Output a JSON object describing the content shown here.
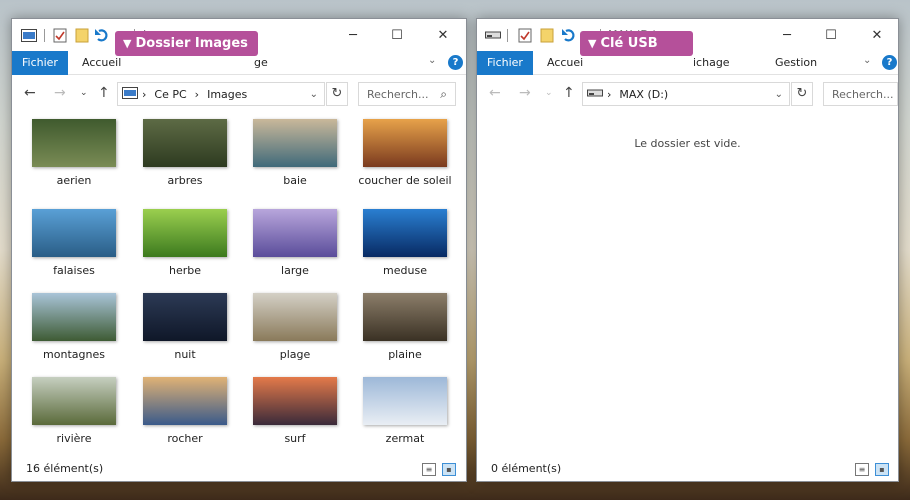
{
  "left": {
    "title": "Images",
    "ribbon": {
      "file": "Fichier",
      "home": "Accueil",
      "view_partial": "ge"
    },
    "callout": "Dossier Images",
    "address": [
      "Ce PC",
      "Images"
    ],
    "search_placeholder": "Recherch...",
    "status": "16 élément(s)",
    "items": [
      {
        "label": "aerien",
        "colors": [
          "#3f5a2e",
          "#7a8c55"
        ]
      },
      {
        "label": "arbres",
        "colors": [
          "#5d6b45",
          "#2e3b20"
        ]
      },
      {
        "label": "baie",
        "colors": [
          "#c9b89a",
          "#406a7a"
        ]
      },
      {
        "label": "coucher de soleil",
        "colors": [
          "#e7a24a",
          "#7a3a1f"
        ]
      },
      {
        "label": "falaises",
        "colors": [
          "#5aa0d6",
          "#2a5d86"
        ]
      },
      {
        "label": "herbe",
        "colors": [
          "#9bcf4f",
          "#3c7a1e"
        ]
      },
      {
        "label": "large",
        "colors": [
          "#b8a6dc",
          "#5a4c9a"
        ]
      },
      {
        "label": "meduse",
        "colors": [
          "#2a7fd1",
          "#082a63"
        ]
      },
      {
        "label": "montagnes",
        "colors": [
          "#a9c4d8",
          "#3e5b34"
        ]
      },
      {
        "label": "nuit",
        "colors": [
          "#2c3a55",
          "#0f1728"
        ]
      },
      {
        "label": "plage",
        "colors": [
          "#d4d0c6",
          "#8a7a5a"
        ]
      },
      {
        "label": "plaine",
        "colors": [
          "#8c7e6a",
          "#3a3124"
        ]
      },
      {
        "label": "rivière",
        "colors": [
          "#c6cfc0",
          "#5a6a3a"
        ]
      },
      {
        "label": "rocher",
        "colors": [
          "#e0b275",
          "#3a5a8a"
        ]
      },
      {
        "label": "surf",
        "colors": [
          "#e47a4a",
          "#3a2a3a"
        ]
      },
      {
        "label": "zermat",
        "colors": [
          "#9db8d8",
          "#e9eef4"
        ]
      }
    ]
  },
  "right": {
    "title": "MAX (D:)",
    "ribbon": {
      "file": "Fichier",
      "home_partial": "Accuei",
      "view_partial": "ichage",
      "manage": "Gestion"
    },
    "callout": "Clé USB",
    "address": [
      "MAX (D:)"
    ],
    "search_placeholder": "Recherch...",
    "empty_message": "Le dossier est vide.",
    "status": "0 élément(s)"
  },
  "icons": {
    "minimize": "─",
    "maximize": "☐",
    "close": "✕",
    "back": "←",
    "forward": "→",
    "up": "↑",
    "refresh": "↻",
    "search": "⌕",
    "dropdown": "⌄",
    "help": "?"
  },
  "colors": {
    "accent": "#1979ca",
    "callout": "#b5509a"
  }
}
